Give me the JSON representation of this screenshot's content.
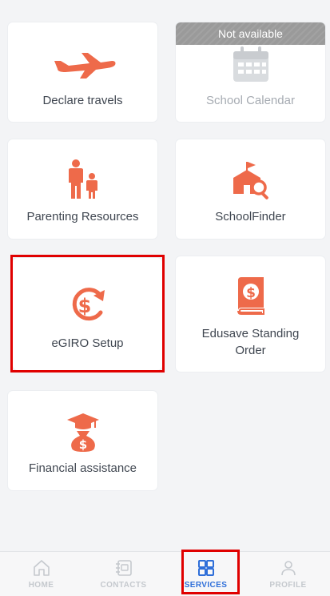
{
  "tiles": {
    "declare_travels": {
      "label": "Declare travels",
      "icon": "airplane-icon"
    },
    "school_calendar": {
      "label": "School Calendar",
      "icon": "calendar-icon",
      "badge": "Not available"
    },
    "parenting_resources": {
      "label": "Parenting Resources",
      "icon": "parent-child-icon"
    },
    "school_finder": {
      "label": "SchoolFinder",
      "icon": "school-search-icon"
    },
    "egiro_setup": {
      "label": "eGIRO Setup",
      "icon": "dollar-refresh-icon"
    },
    "edusave_standing_order": {
      "label_line1": "Edusave Standing",
      "label_line2": "Order",
      "icon": "dollar-book-icon"
    },
    "financial_assistance": {
      "label": "Financial assistance",
      "icon": "graduation-moneybag-icon"
    }
  },
  "nav": {
    "home": {
      "label": "HOME",
      "icon": "home-icon"
    },
    "contacts": {
      "label": "CONTACTS",
      "icon": "contacts-icon"
    },
    "services": {
      "label": "SERVICES",
      "icon": "grid-icon",
      "active": true
    },
    "profile": {
      "label": "PROFILE",
      "icon": "person-icon"
    }
  },
  "colors": {
    "accent_orange": "#ee6a4a",
    "active_blue": "#2f6fd9",
    "highlight_red": "#e00000",
    "badge_gray": "#9a9a9a"
  }
}
